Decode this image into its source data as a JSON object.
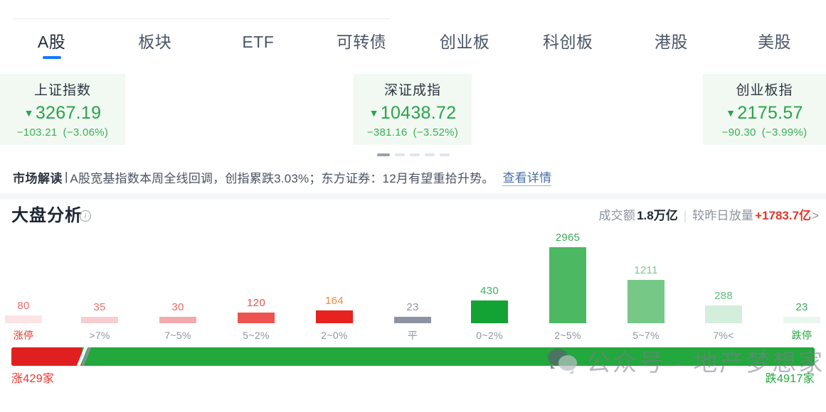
{
  "tabs": [
    {
      "label": "A股",
      "active": true
    },
    {
      "label": "板块",
      "active": false
    },
    {
      "label": "ETF",
      "active": false
    },
    {
      "label": "可转债",
      "active": false
    },
    {
      "label": "创业板",
      "active": false
    },
    {
      "label": "科创板",
      "active": false
    },
    {
      "label": "港股",
      "active": false
    },
    {
      "label": "美股",
      "active": false
    }
  ],
  "index_cards": [
    {
      "name": "上证指数",
      "value": "3267.19",
      "caret": "▼",
      "change": "−103.21",
      "change_pct": "(−3.06%)",
      "direction": "down",
      "color": "#2aa34a",
      "left": 0,
      "width": 176
    },
    {
      "name": "深证成指",
      "value": "10438.72",
      "caret": "▼",
      "change": "−381.16",
      "change_pct": "(−3.52%)",
      "direction": "down",
      "color": "#2aa34a",
      "left": 497,
      "width": 166
    },
    {
      "name": "创业板指",
      "value": "2175.57",
      "caret": "▼",
      "change": "−90.30",
      "change_pct": "(−3.99%)",
      "direction": "down",
      "color": "#2aa34a",
      "left": 988,
      "width": 173
    }
  ],
  "carousel": {
    "count": 5,
    "active_index": 0
  },
  "interpretation": {
    "label": "市场解读",
    "separator": "|",
    "text": "A股宽基指数本周全线回调，创指累跌3.03%；东方证券：12月有望重拾升势。",
    "link": "查看详情"
  },
  "analysis": {
    "title": "大盘分析",
    "info_icon": "info-icon",
    "turnover_label": "成交额",
    "turnover_value": "1.8万亿",
    "divider": "|",
    "compare_label": "较昨日放量",
    "compare_value": "+1783.7亿",
    "chevron": ">"
  },
  "chart_data": {
    "type": "bar",
    "title": "大盘分析",
    "xlabel": "",
    "ylabel": "",
    "ylim": [
      0,
      2965
    ],
    "grid": false,
    "legend": "none",
    "categories": [
      "涨停",
      ">7%",
      "7~5%",
      "5~2%",
      "2~0%",
      "平",
      "0~2%",
      "2~5%",
      "5~7%",
      "7%<",
      "跌停"
    ],
    "values": [
      80,
      35,
      30,
      120,
      164,
      23,
      430,
      2965,
      1211,
      288,
      23
    ],
    "bar_colors": [
      "#fbe4e5",
      "#f7cdd0",
      "#f3aaad",
      "#ef5350",
      "#e8231f",
      "#8d93a1",
      "#13a335",
      "#4cb862",
      "#76c887",
      "#d3eedb",
      "#e9f6ed"
    ],
    "label_colors": [
      "#ef6f6c",
      "#e8726f",
      "#e66a67",
      "#e8504c",
      "#ef8a42",
      "#8e95a1",
      "#3eb35c",
      "#3da85c",
      "#7fc68e",
      "#64bd7d",
      "#3da85c"
    ],
    "category_colors": [
      "#e8342c",
      "#8e95a1",
      "#8e95a1",
      "#8e95a1",
      "#8e95a1",
      "#8e95a1",
      "#8e95a1",
      "#8e95a1",
      "#8e95a1",
      "#8e95a1",
      "#22a83c"
    ]
  },
  "ratio": {
    "up_label": "涨429家",
    "down_label": "跌4917家",
    "up_count": 429,
    "down_count": 4917,
    "up_percent": 8.8,
    "up_color": "#e02020",
    "down_color": "#22a83c"
  },
  "watermark": {
    "icon": "wechat-icon",
    "text": "公众号 · 地产梦想家"
  }
}
